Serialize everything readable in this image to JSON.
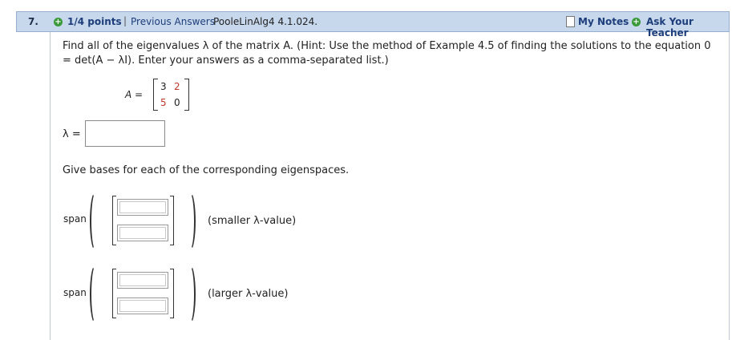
{
  "header": {
    "question_number": "7.",
    "points": "1/4 points",
    "separator": "|",
    "previous_answers": "Previous Answers",
    "question_id": "PooleLinAlg4 4.1.024.",
    "my_notes": "My Notes",
    "ask_teacher": "Ask Your Teacher"
  },
  "question": {
    "text": "Find all of the eigenvalues λ of the matrix A. (Hint: Use the method of Example 4.5 of finding the solutions to the equation 0 = det(A − λI). Enter your answers as a comma-separated list.)",
    "matrix_name": "A",
    "matrix_eq": " =",
    "matrix": [
      [
        "3",
        "2"
      ],
      [
        "5",
        "0"
      ]
    ],
    "lambda_label": "λ =",
    "lambda_value": ""
  },
  "eigenspaces": {
    "instruction": "Give bases for each of the corresponding eigenspaces.",
    "span_label": "span",
    "smaller": {
      "note": "(smaller λ-value)",
      "v1": "",
      "v2": ""
    },
    "larger": {
      "note": "(larger λ-value)",
      "v1": "",
      "v2": ""
    }
  },
  "colors": {
    "header_bg": "#c7d7ec",
    "link": "#1d3e7b",
    "plus_icon": "#3a9a3a",
    "matrix_highlight": "#c0392b"
  }
}
